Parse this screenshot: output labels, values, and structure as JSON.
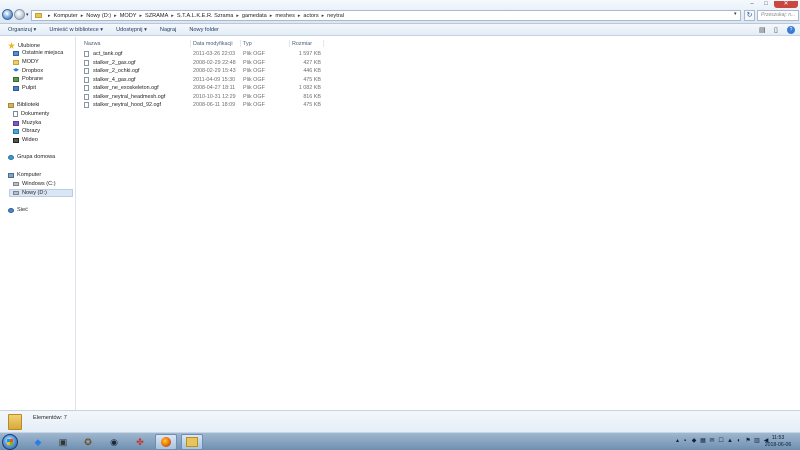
{
  "addressbar": {
    "breadcrumbs": [
      "Komputer",
      "Nowy (D:)",
      "MODY",
      "SZRAMA",
      "S.T.A.L.K.E.R. Szrama",
      "gamedata",
      "meshes",
      "actors",
      "neytral"
    ],
    "search_placeholder": "Przeszukaj: n..."
  },
  "toolbar": {
    "organize_label": "Organizuj ▾",
    "include_label": "Umieść w bibliotece ▾",
    "share_label": "Udostępnij ▾",
    "burn_label": "Nagraj",
    "new_folder_label": "Nowy folder"
  },
  "navpane": {
    "favorites_header": "Ulubione",
    "favorites": [
      "Ostatnie miejsca",
      "MODY",
      "Dropbox",
      "Pobrane",
      "Pulpit"
    ],
    "libraries_header": "Biblioteki",
    "libraries": [
      "Dokumenty",
      "Muzyka",
      "Obrazy",
      "Wideo"
    ],
    "homegroup": "Grupa domowa",
    "computer_header": "Komputer",
    "drives": [
      "Windows (C:)",
      "Nowy (D:)"
    ],
    "network": "Sieć"
  },
  "filelist": {
    "columns": {
      "name": "Nazwa",
      "date": "Data modyfikacji",
      "type": "Typ",
      "size": "Rozmiar"
    },
    "files": [
      {
        "name": "act_tank.ogf",
        "date": "2011-03-26 22:03",
        "type": "Plik OGF",
        "size": "1 597 KB"
      },
      {
        "name": "stalker_2_gas.ogf",
        "date": "2008-02-29 22:48",
        "type": "Plik OGF",
        "size": "427 KB"
      },
      {
        "name": "stalker_2_ochki.ogf",
        "date": "2008-02-29 15:43",
        "type": "Plik OGF",
        "size": "446 KB"
      },
      {
        "name": "stalker_4_gas.ogf",
        "date": "2011-04-09 15:30",
        "type": "Plik OGF",
        "size": "475 KB"
      },
      {
        "name": "stalker_ne_exoskeleton.ogf",
        "date": "2008-04-27 18:11",
        "type": "Plik OGF",
        "size": "1 082 KB"
      },
      {
        "name": "stalker_neytral_headmesh.ogf",
        "date": "2010-10-31 12:29",
        "type": "Plik OGF",
        "size": "816 KB"
      },
      {
        "name": "stalker_neytral_hood_92.ogf",
        "date": "2008-06-11 18:09",
        "type": "Plik OGF",
        "size": "475 KB"
      }
    ]
  },
  "details": {
    "count_text": "Elementów: 7"
  },
  "taskbar": {
    "clock_time": "11:53",
    "clock_date": "2018-06-06"
  }
}
